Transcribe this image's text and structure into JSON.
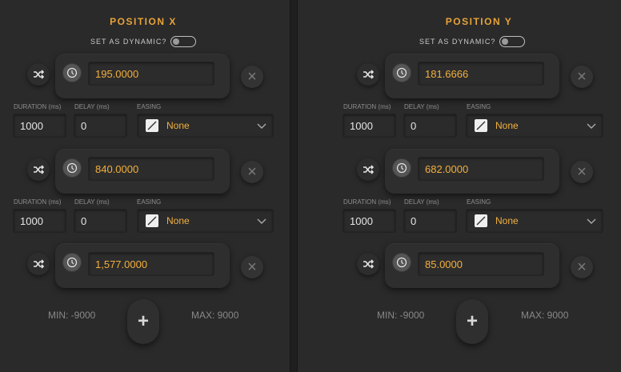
{
  "left": {
    "title": "POSITION X",
    "dynamic_label": "SET AS DYNAMIC?",
    "keyframes": [
      {
        "value": "195.0000"
      },
      {
        "value": "840.0000"
      },
      {
        "value": "1,577.0000"
      }
    ],
    "transitions": [
      {
        "duration_label": "DURATION (ms)",
        "delay_label": "DELAY (ms)",
        "easing_label": "EASING",
        "duration": "1000",
        "delay": "0",
        "easing": "None"
      },
      {
        "duration_label": "DURATION (ms)",
        "delay_label": "DELAY (ms)",
        "easing_label": "EASING",
        "duration": "1000",
        "delay": "0",
        "easing": "None"
      }
    ],
    "min": "MIN: -9000",
    "max": "MAX: 9000",
    "add_label": "+"
  },
  "right": {
    "title": "POSITION Y",
    "dynamic_label": "SET AS DYNAMIC?",
    "keyframes": [
      {
        "value": "181.6666"
      },
      {
        "value": "682.0000"
      },
      {
        "value": "85.0000"
      }
    ],
    "transitions": [
      {
        "duration_label": "DURATION (ms)",
        "delay_label": "DELAY (ms)",
        "easing_label": "EASING",
        "duration": "1000",
        "delay": "0",
        "easing": "None"
      },
      {
        "duration_label": "DURATION (ms)",
        "delay_label": "DELAY (ms)",
        "easing_label": "EASING",
        "duration": "1000",
        "delay": "0",
        "easing": "None"
      }
    ],
    "min": "MIN: -9000",
    "max": "MAX: 9000",
    "add_label": "+"
  },
  "colors": {
    "accent": "#e8a33a",
    "value_text": "#f2b03e",
    "background": "#2a2a2a"
  },
  "icons": {
    "shuffle": "shuffle-icon",
    "clock": "clock-icon",
    "close": "close-icon",
    "easing": "linear-easing-icon",
    "chevron": "chevron-down-icon",
    "add": "plus-icon"
  }
}
